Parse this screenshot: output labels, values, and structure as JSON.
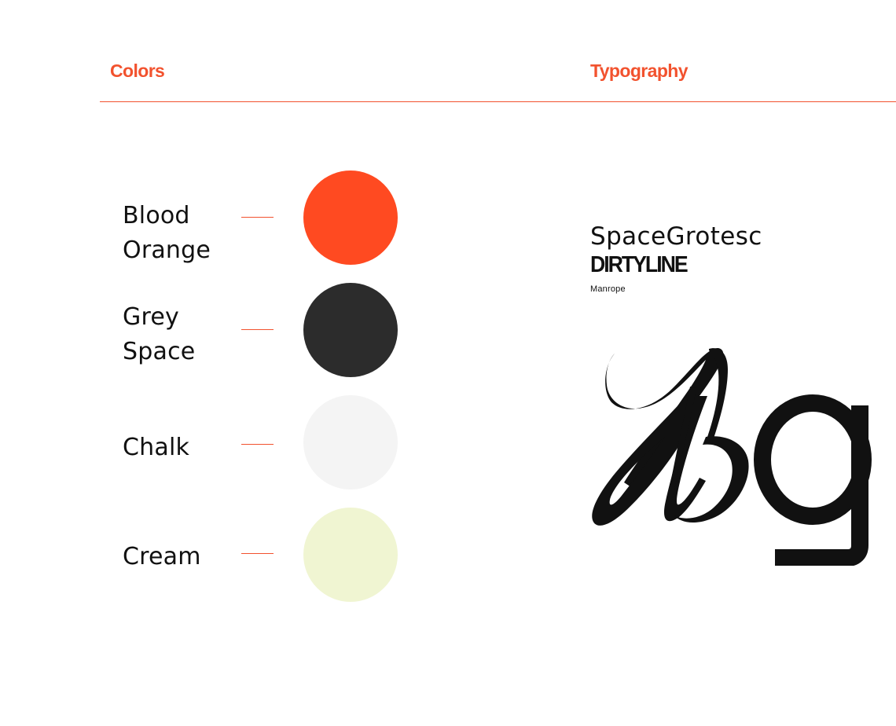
{
  "headings": {
    "colors": "Colors",
    "typography": "Typography"
  },
  "palette": [
    {
      "label": "Blood\nOrange",
      "color": "#FF4A21"
    },
    {
      "label": "Grey\nSpace",
      "color": "#2C2C2C"
    },
    {
      "label": "Chalk",
      "color": "#F4F4F4"
    },
    {
      "label": "Cream",
      "color": "#F0F5D2"
    }
  ],
  "typography": {
    "fonts": [
      "SpaceGrotesc",
      "DIRTYLINE",
      "Manrope"
    ],
    "glyph_sample": "ag"
  },
  "colors": {
    "accent": "#F2522E",
    "ink": "#111111",
    "background": "#FFFFFF"
  }
}
